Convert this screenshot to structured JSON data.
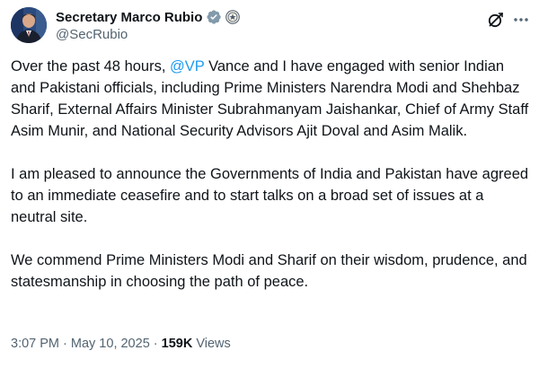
{
  "author": {
    "display_name": "Secretary Marco Rubio",
    "handle": "@SecRubio",
    "verified_badge_color": "#829aab",
    "avatar_icon": "profile-photo"
  },
  "actions": {
    "grok_icon": "grok-icon",
    "more_icon": "more-options-icon"
  },
  "tweet": {
    "p1_before": "Over the past 48 hours, ",
    "p1_mention": "@VP",
    "p1_after": " Vance and I have engaged with senior Indian and Pakistani officials, including Prime Ministers Narendra Modi and Shehbaz Sharif, External Affairs Minister Subrahmanyam Jaishankar, Chief of Army Staff Asim Munir, and National Security Advisors Ajit Doval and Asim Malik.",
    "p2": "I am pleased to announce the Governments of India and Pakistan have agreed to an immediate ceasefire and to start talks on a broad set of issues at a neutral site.",
    "p3": "We commend Prime Ministers Modi and Sharif on their wisdom, prudence, and statesmanship in choosing the path of peace."
  },
  "meta": {
    "time": "3:07 PM",
    "separator": " · ",
    "date": "May 10, 2025",
    "views_count": "159K",
    "views_label": " Views"
  },
  "colors": {
    "text": "#0f1419",
    "secondary": "#536471",
    "link": "#1d9bf0"
  }
}
